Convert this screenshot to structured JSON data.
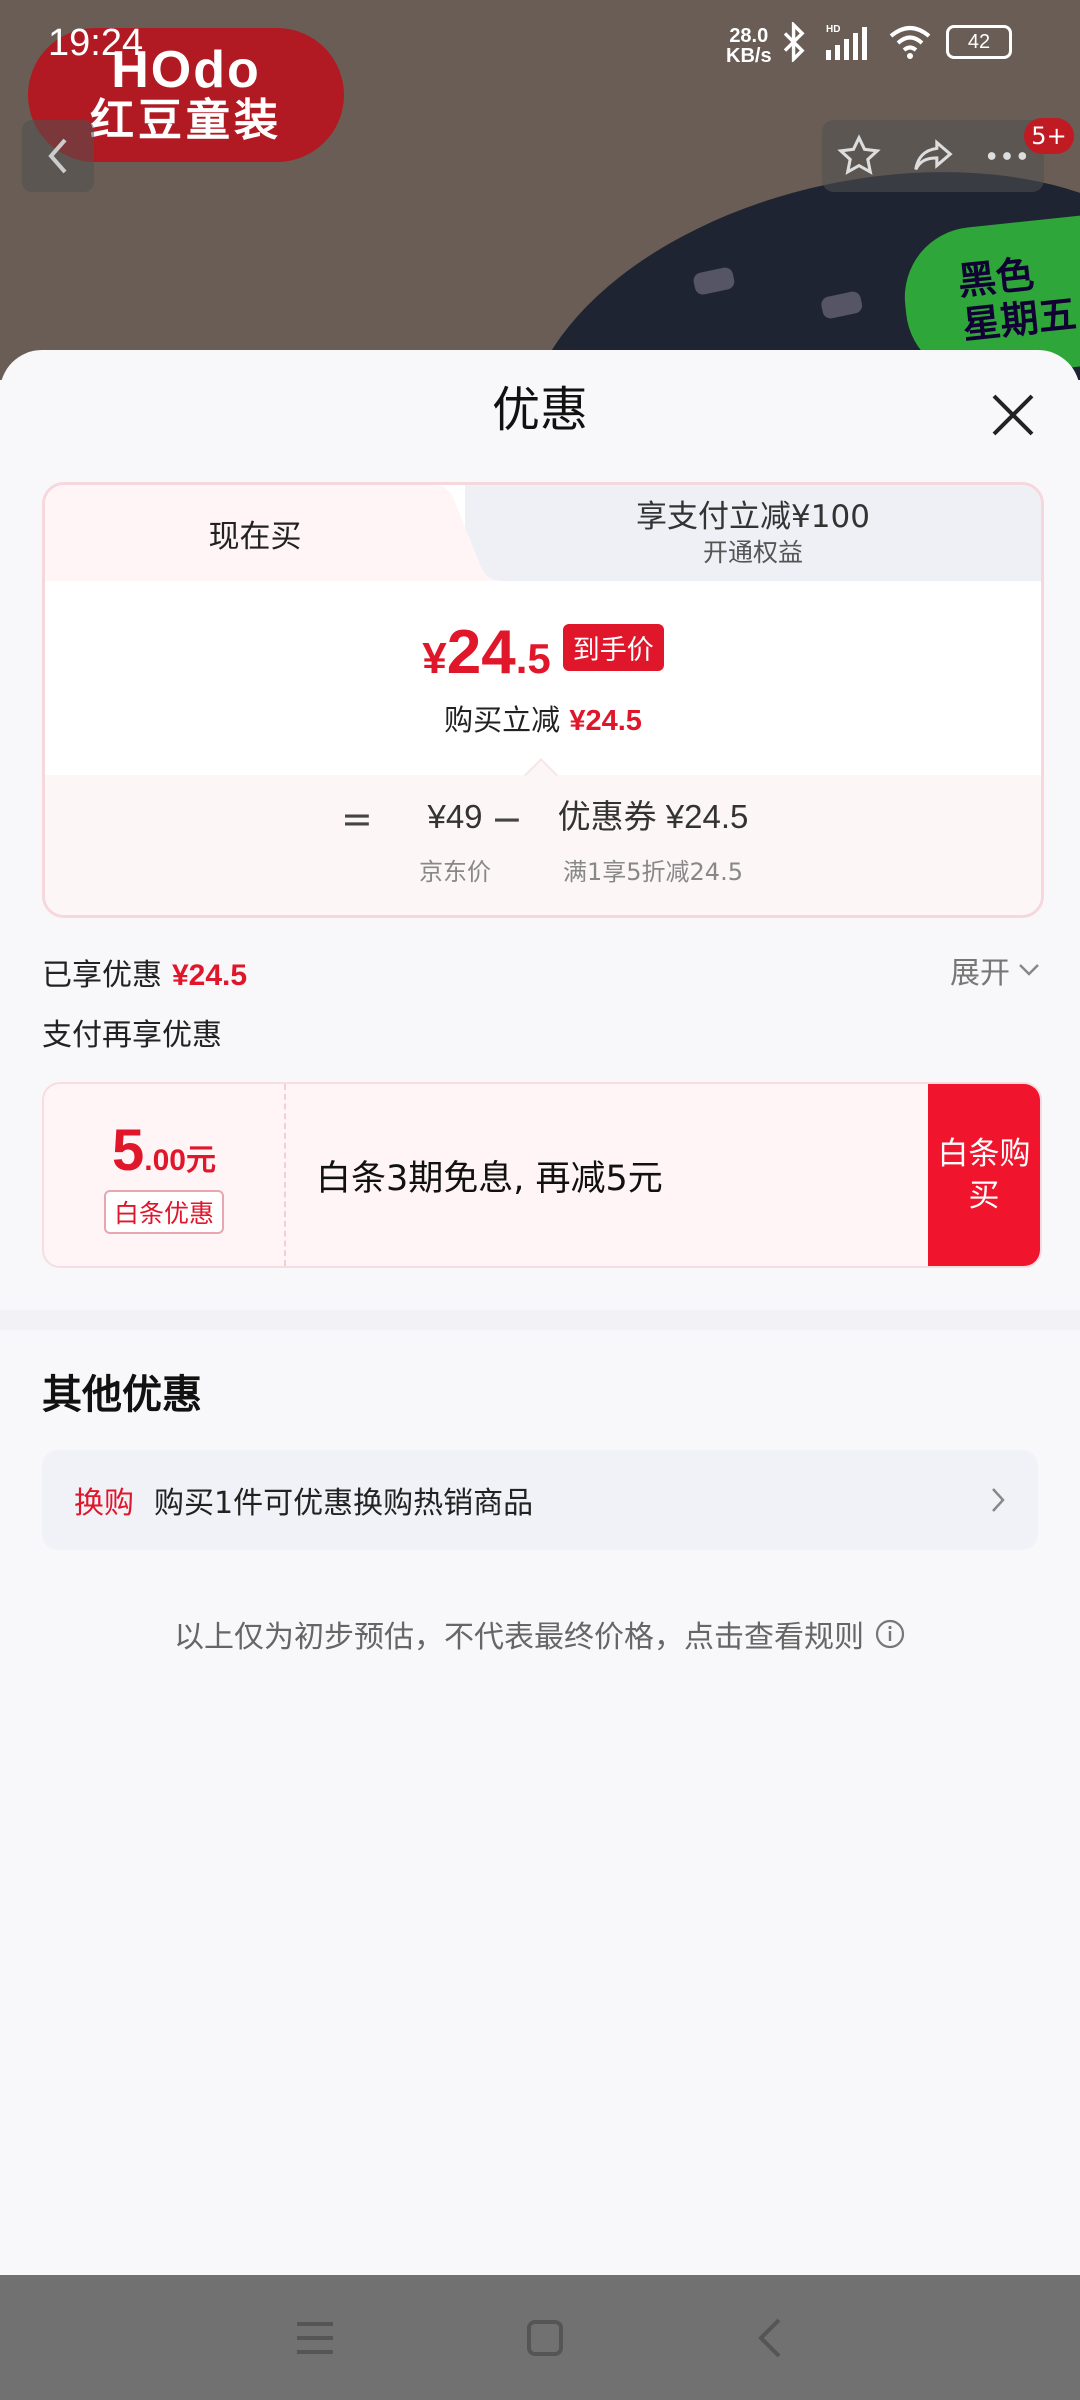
{
  "status_bar": {
    "time": "19:24",
    "net_speed_value": "28.0",
    "net_speed_unit": "KB/s",
    "battery": "42"
  },
  "background": {
    "brand_en": "HOdo",
    "brand_cn": "红豆童装",
    "sticker_line1": "黑色",
    "sticker_line2": "星期五",
    "cart_badge": "5+"
  },
  "sheet": {
    "title": "优惠"
  },
  "tabs": {
    "now_buy": "现在买",
    "pay_reduce": "享支付立减¥100",
    "pay_reduce_sub": "开通权益"
  },
  "price": {
    "yen": "¥",
    "int": "24",
    "dec": ".5",
    "final_tag": "到手价",
    "reduce_label": "购买立减",
    "reduce_value": "¥24.5"
  },
  "formula": {
    "eq": "=",
    "jd_price": "¥49",
    "jd_label": "京东价",
    "minus": "−",
    "coupon_price": "优惠券 ¥24.5",
    "coupon_label": "满1享5折减24.5"
  },
  "enjoyed": {
    "label": "已享优惠",
    "value": "¥24.5",
    "expand": "展开"
  },
  "pay_more": "支付再享优惠",
  "baitiao": {
    "amount_int": "5",
    "amount_dec": ".00元",
    "tag": "白条优惠",
    "desc": "白条3期免息, 再减5元",
    "button": "白条购买"
  },
  "other": {
    "title": "其他优惠",
    "swap_tag": "换购",
    "swap_text": "购买1件可优惠换购热销商品"
  },
  "disclaimer": "以上仅为初步预估，不代表最终价格，点击查看规则",
  "colors": {
    "accent": "#e0162b",
    "button": "#f0142c"
  }
}
